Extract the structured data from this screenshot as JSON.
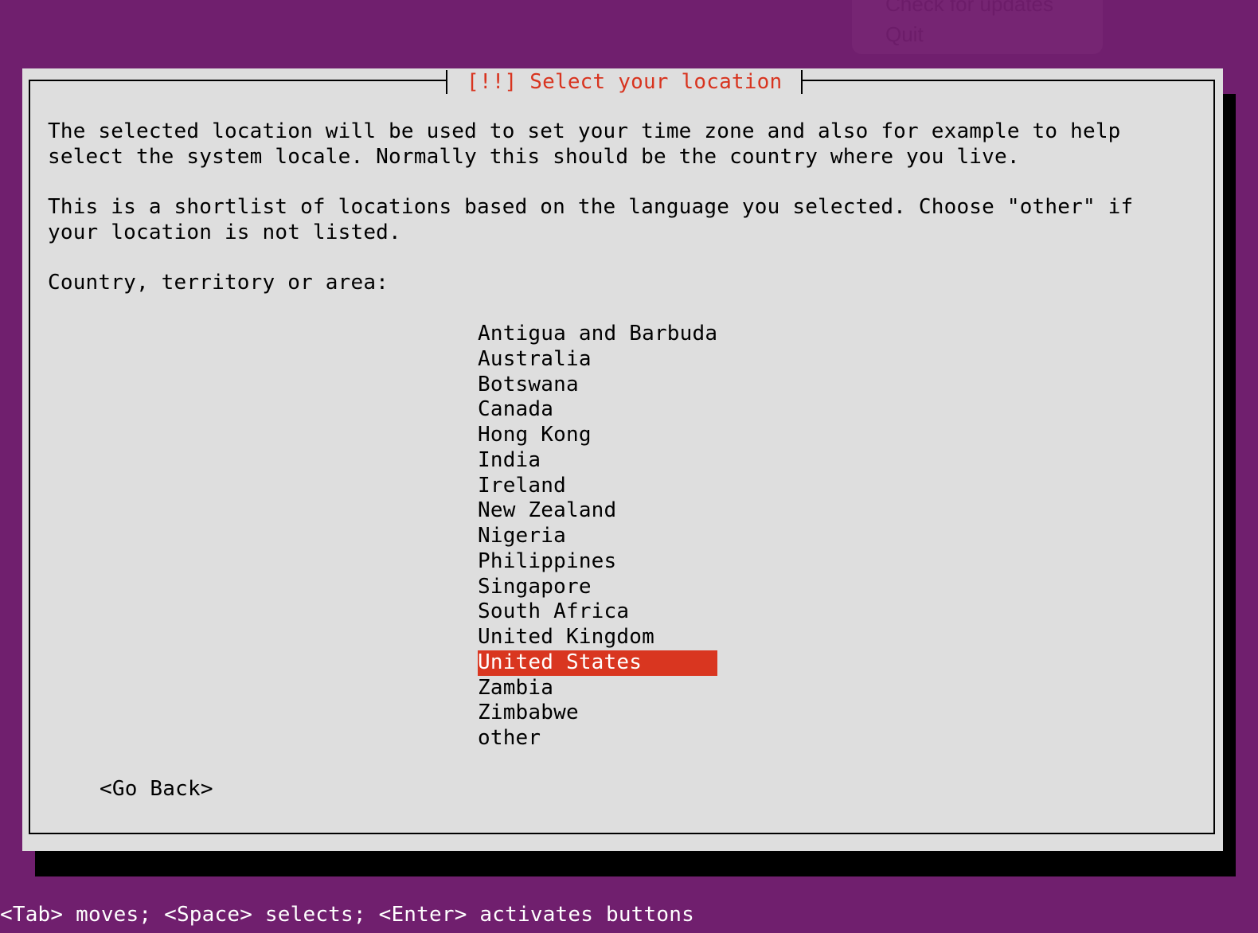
{
  "background_menu": {
    "items": [
      "Check for updates",
      "Quit"
    ]
  },
  "dialog": {
    "title": "[!!] Select your location",
    "paragraph1_line1": "The selected location will be used to set your time zone and also for example to help",
    "paragraph1_line2": "select the system locale. Normally this should be the country where you live.",
    "paragraph2_line1": "This is a shortlist of locations based on the language you selected. Choose \"other\" if",
    "paragraph2_line2": "your location is not listed.",
    "prompt": "Country, territory or area:",
    "countries": [
      "Antigua and Barbuda",
      "Australia",
      "Botswana",
      "Canada",
      "Hong Kong",
      "India",
      "Ireland",
      "New Zealand",
      "Nigeria",
      "Philippines",
      "Singapore",
      "South Africa",
      "United Kingdom",
      "United States",
      "Zambia",
      "Zimbabwe",
      "other"
    ],
    "selected": "United States",
    "go_back_label": "<Go Back>"
  },
  "help_line": "<Tab> moves; <Space> selects; <Enter> activates buttons",
  "colors": {
    "background": "#701f6e",
    "dialog": "#dedede",
    "accent": "#d93620"
  }
}
